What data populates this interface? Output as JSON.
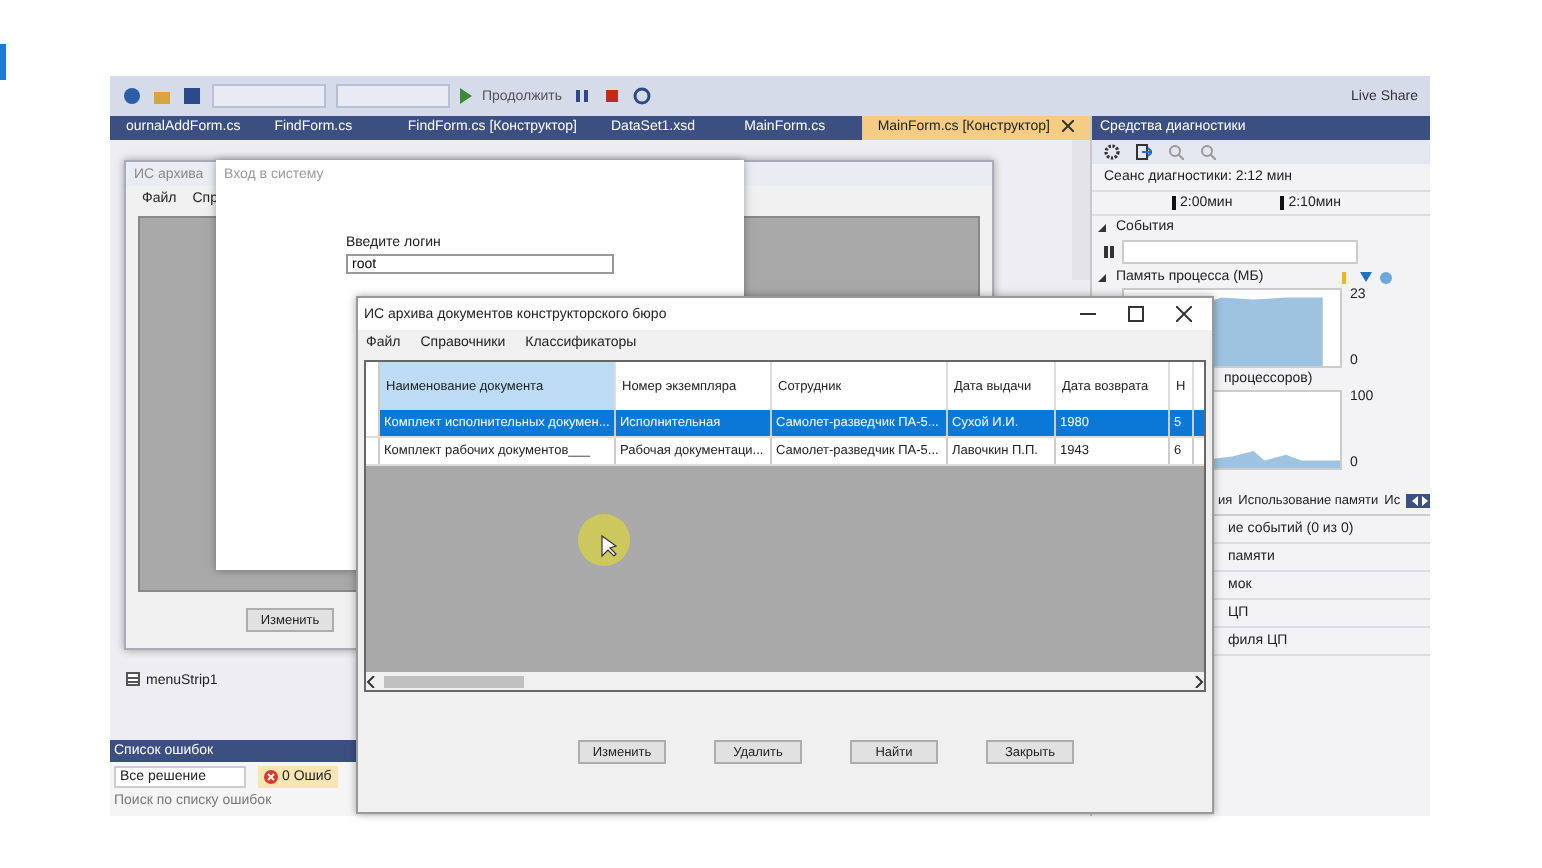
{
  "toolbar": {
    "run_label": "Продолжить",
    "live_share": "Live Share"
  },
  "tabs": [
    {
      "label": "ournalAddForm.cs",
      "selected": false
    },
    {
      "label": "FindForm.cs",
      "selected": false
    },
    {
      "label": "FindForm.cs [Конструктор]",
      "selected": false
    },
    {
      "label": "DataSet1.xsd",
      "selected": false
    },
    {
      "label": "MainForm.cs",
      "selected": false
    },
    {
      "label": "MainForm.cs [Конструктор]",
      "selected": true
    }
  ],
  "designer": {
    "form_title": "ИС архива",
    "menu": [
      "Файл",
      "Спр"
    ],
    "button": "Изменить",
    "component": "menuStrip1"
  },
  "login_dialog": {
    "title": "Вход в систему",
    "login_label": "Введите логин",
    "login_value": "root"
  },
  "main_window": {
    "title": "ИС архива документов конструкторского бюро",
    "menu": [
      "Файл",
      "Справочники",
      "Классификаторы"
    ],
    "columns": [
      {
        "label": "Наименование документа",
        "selected": true
      },
      {
        "label": "Номер экземпляра",
        "selected": false
      },
      {
        "label": "Сотрудник",
        "selected": false
      },
      {
        "label": "Дата выдачи",
        "selected": false
      },
      {
        "label": "Дата возврата",
        "selected": false
      },
      {
        "label": "Н",
        "selected": false
      }
    ],
    "rows": [
      {
        "selected": true,
        "cells": [
          "Комплект исполнительных докумен...",
          "Исполнительная",
          "Самолет-разведчик ПА-5...",
          "Сухой И.И.",
          "1980",
          "5"
        ]
      },
      {
        "selected": false,
        "cells": [
          "Комплект рабочих документов___",
          "Рабочая документаци...",
          "Самолет-разведчик ПА-5...",
          "Лавочкин П.П.",
          "1943",
          "6"
        ]
      }
    ],
    "buttons": [
      "Изменить",
      "Удалить",
      "Найти",
      "Закрыть"
    ]
  },
  "diagnostics": {
    "title": "Средства диагностики",
    "session": "Сеанс диагностики: 2:12 мин",
    "timeline": [
      "2:00мин",
      "2:10мин"
    ],
    "events": "События",
    "memory": "Память процесса (МБ)",
    "memory_ticks": [
      "23",
      "0"
    ],
    "cpu": "процессоров)",
    "cpu_ticks": [
      "100",
      "0"
    ],
    "tabs": [
      {
        "label": "ия",
        "selected": false
      },
      {
        "label": "Использование памяти",
        "selected": false
      },
      {
        "label": "Ис",
        "selected": false
      }
    ],
    "items": [
      "ие событий (0 из 0)",
      "памяти",
      "мок",
      "ЦП",
      "филя ЦП"
    ]
  },
  "error_list": {
    "title": "Список ошибок",
    "scope": "Все решение",
    "errors": "0 Ошиб",
    "search_placeholder": "Поиск по списку ошибок"
  }
}
